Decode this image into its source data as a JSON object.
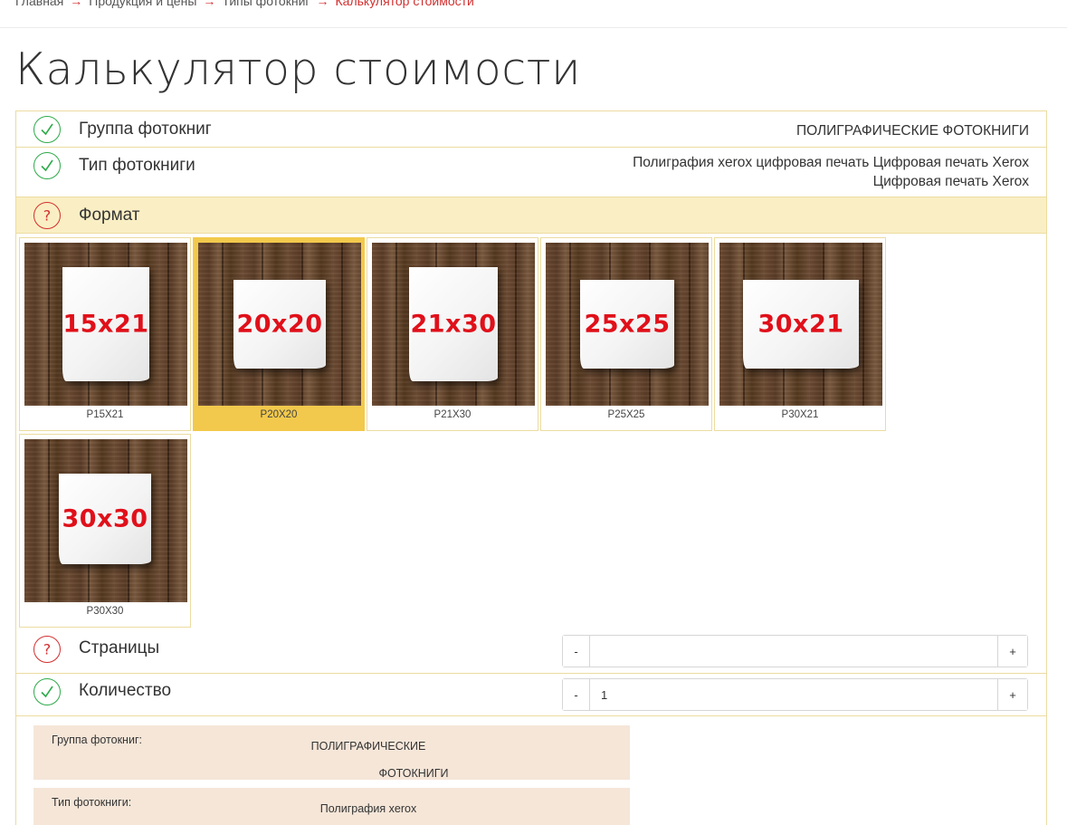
{
  "breadcrumb": {
    "items": [
      "Главная",
      "Продукция и цены",
      "Типы фотокниг"
    ],
    "current": "Калькулятор стоимости",
    "separator": "→"
  },
  "page_title": "Калькулятор стоимости",
  "calculator": {
    "group": {
      "label": "Группа фотокниг",
      "value": "ПОЛИГРАФИЧЕСКИЕ ФОТОКНИГИ",
      "status": "done"
    },
    "type": {
      "label": "Тип фотокниги",
      "value_line1": "Полиграфия xerox цифровая печать Цифровая печать Xerox",
      "value_line2": "Цифровая печать Xerox",
      "status": "done"
    },
    "format": {
      "label": "Формат",
      "status": "pending",
      "selected": "P20X20",
      "options": [
        {
          "image_text": "15x21",
          "caption": "P15X21"
        },
        {
          "image_text": "20x20",
          "caption": "P20X20"
        },
        {
          "image_text": "21x30",
          "caption": "P21X30"
        },
        {
          "image_text": "25x25",
          "caption": "P25X25"
        },
        {
          "image_text": "30x21",
          "caption": "P30X21"
        },
        {
          "image_text": "30x30",
          "caption": "P30X30"
        }
      ]
    },
    "pages": {
      "label": "Страницы",
      "status": "pending",
      "minus": "-",
      "plus": "+",
      "value": ""
    },
    "quantity": {
      "label": "Количество",
      "status": "done",
      "minus": "-",
      "plus": "+",
      "value": "1"
    }
  },
  "summary": [
    {
      "key": "Группа фотокниг:",
      "value_line1": "ПОЛИГРАФИЧЕСКИЕ",
      "value_line2": "ФОТОКНИГИ"
    },
    {
      "key": "Тип фотокниги:",
      "value_line1": "Полиграфия xerox",
      "value_line2": ""
    }
  ],
  "colors": {
    "accent_red": "#d32f2f",
    "check_green": "#2eaa4a",
    "format_highlight": "#faefc4",
    "selected_card": "#f2c94c",
    "summary_bg": "#f5e6d8",
    "border": "#ecdca0",
    "size_label_red": "#e0101a"
  },
  "icons": {
    "done": "check-circle-icon",
    "pending": "question-circle-icon"
  }
}
